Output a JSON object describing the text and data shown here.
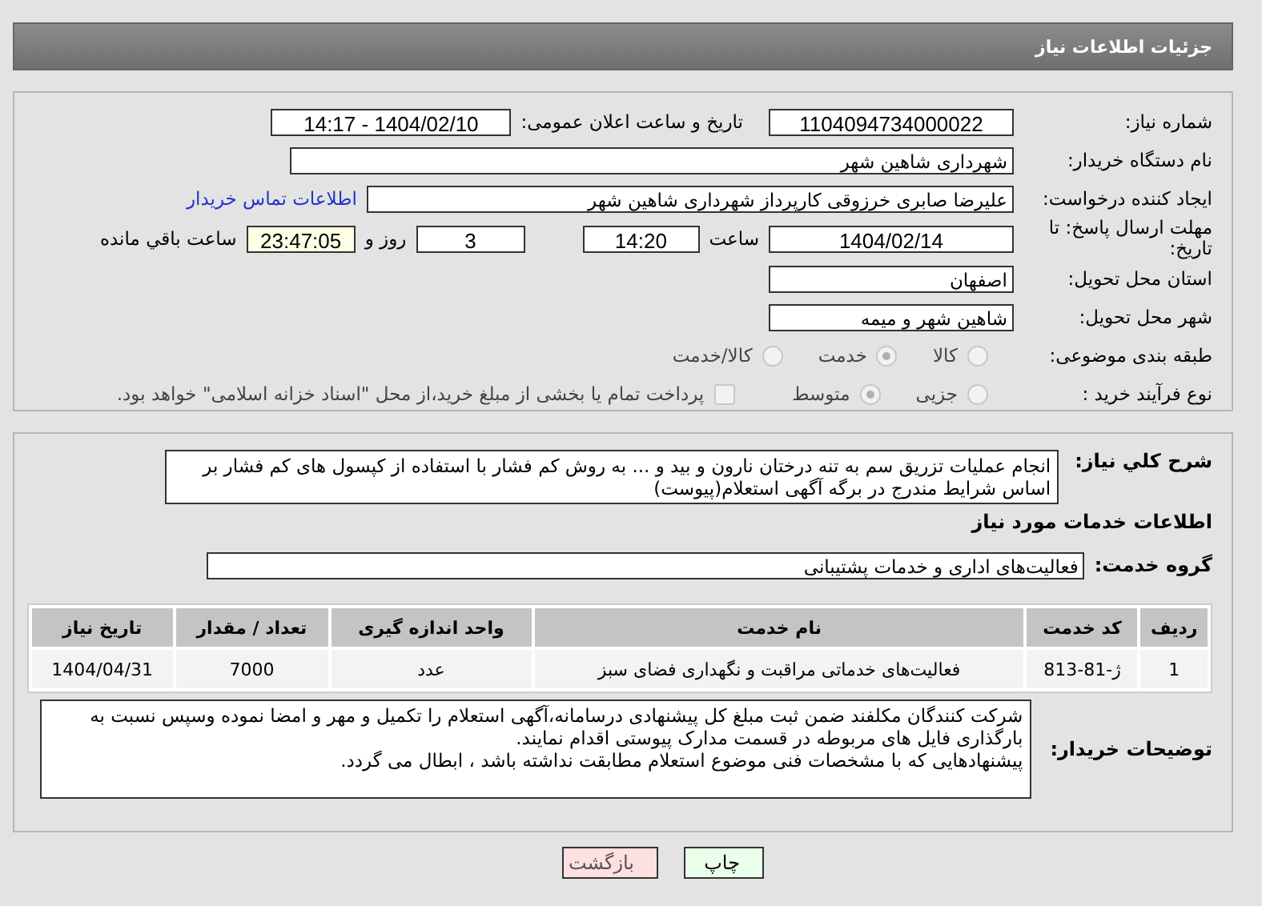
{
  "header": {
    "title": "جزئیات اطلاعات نیاز"
  },
  "details": {
    "need_number": {
      "label": "شماره نیاز:",
      "value": "1104094734000022"
    },
    "announce": {
      "label": "تاریخ و ساعت اعلان عمومی:",
      "value": "1404/02/10 - 14:17"
    },
    "buyer_org": {
      "label": "نام دستگاه خریدار:",
      "value": "شهرداری شاهین شهر"
    },
    "requester": {
      "label": "ایجاد کننده درخواست:",
      "value": "علیرضا صابری خرزوقی کارپرداز شهرداری شاهین شهر",
      "link": "اطلاعات تماس خریدار"
    },
    "deadline": {
      "label": "مهلت ارسال پاسخ: تا تاریخ:",
      "date": "1404/02/14",
      "time_label": "ساعت",
      "time": "14:20",
      "days": "3",
      "days_label": "روز و",
      "remaining": "23:47:05",
      "remaining_label": "ساعت باقي مانده"
    },
    "province": {
      "label": "استان محل تحویل:",
      "value": "اصفهان"
    },
    "city": {
      "label": "شهر محل تحویل:",
      "value": "شاهین شهر و میمه"
    },
    "category": {
      "label": "طبقه بندی موضوعی:",
      "options": [
        {
          "label": "کالا",
          "selected": false
        },
        {
          "label": "خدمت",
          "selected": true
        },
        {
          "label": "کالا/خدمت",
          "selected": false
        }
      ]
    },
    "process": {
      "label": "نوع فرآیند خرید :",
      "options": [
        {
          "label": "جزیی",
          "selected": false
        },
        {
          "label": "متوسط",
          "selected": true
        }
      ],
      "treasury": {
        "checked": false,
        "label": "پرداخت تمام یا بخشی از مبلغ خرید،از محل \"اسناد خزانه اسلامی\" خواهد بود."
      }
    }
  },
  "services": {
    "description": {
      "label": "شرح کلي نیاز:",
      "value": "انجام عملیات تزریق سم به تنه درختان نارون و بید و ... به روش کم فشار با استفاده از کپسول های کم فشار بر اساس شرایط  مندرج در برگه آگهی استعلام(پیوست)"
    },
    "heading": "اطلاعات خدمات مورد نیاز",
    "group": {
      "label": "گروه خدمت:",
      "value": "فعالیت‌های اداری و خدمات پشتیبانی"
    },
    "table": {
      "columns": [
        "ردیف",
        "کد خدمت",
        "نام خدمت",
        "واحد اندازه گیری",
        "تعداد / مقدار",
        "تاریخ نیاز"
      ],
      "rows": [
        [
          "1",
          "ژ-81-813",
          "فعالیت‌های خدماتی مراقبت و نگهداری فضای سبز",
          "عدد",
          "7000",
          "1404/04/31"
        ]
      ]
    },
    "buyer_notes": {
      "label": "توضیحات خریدار:",
      "lines": [
        "شرکت کنندگان مکلفند ضمن ثبت مبلغ کل پیشنهادی درسامانه،آگهی استعلام را  تکمیل و مهر و امضا نموده وسپس نسبت به بارگذاری فایل های مربوطه در قسمت مدارک پیوستی اقدام نمایند.",
        "پیشنهادهایی که با مشخصات فنی موضوع استعلام مطابقت نداشته باشد ، ابطال می گردد."
      ]
    }
  },
  "buttons": [
    {
      "kind": "print",
      "label": "چاپ"
    },
    {
      "kind": "back",
      "label": "بازگشت"
    }
  ]
}
